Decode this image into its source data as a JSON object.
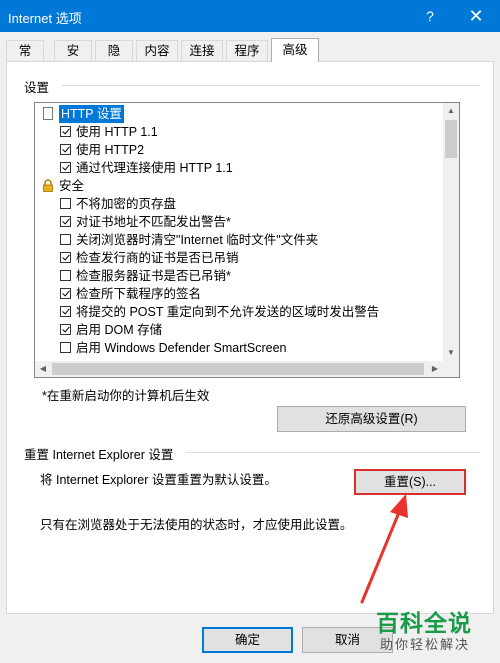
{
  "window": {
    "title": "Internet 选项",
    "help_label": "?",
    "close_label": "✕",
    "accent_color": "#0078d7"
  },
  "tabs": [
    {
      "label": "常规",
      "active": false
    },
    {
      "label": "安全",
      "active": false
    },
    {
      "label": "隐私",
      "active": false
    },
    {
      "label": "内容",
      "active": false
    },
    {
      "label": "连接",
      "active": false
    },
    {
      "label": "程序",
      "active": false
    },
    {
      "label": "高级",
      "active": true
    }
  ],
  "settings": {
    "label": "设置",
    "items": [
      {
        "kind": "category",
        "icon": "document-icon",
        "label": "HTTP 设置",
        "selected": true
      },
      {
        "kind": "option",
        "checked": true,
        "label": "使用 HTTP 1.1"
      },
      {
        "kind": "option",
        "checked": true,
        "label": "使用 HTTP2"
      },
      {
        "kind": "option",
        "checked": true,
        "label": "通过代理连接使用 HTTP 1.1"
      },
      {
        "kind": "category",
        "icon": "lock-icon",
        "label": "安全",
        "selected": false
      },
      {
        "kind": "option",
        "checked": false,
        "label": "不将加密的页存盘"
      },
      {
        "kind": "option",
        "checked": true,
        "label": "对证书地址不匹配发出警告*"
      },
      {
        "kind": "option",
        "checked": false,
        "label": "关闭浏览器时清空\"Internet 临时文件\"文件夹"
      },
      {
        "kind": "option",
        "checked": true,
        "label": "检查发行商的证书是否已吊销"
      },
      {
        "kind": "option",
        "checked": false,
        "label": "检查服务器证书是否已吊销*"
      },
      {
        "kind": "option",
        "checked": true,
        "label": "检查所下载程序的签名"
      },
      {
        "kind": "option",
        "checked": true,
        "label": "将提交的 POST 重定向到不允许发送的区域时发出警告"
      },
      {
        "kind": "option",
        "checked": true,
        "label": "启用 DOM 存储"
      },
      {
        "kind": "option",
        "checked": false,
        "label": "启用 Windows Defender SmartScreen"
      }
    ],
    "restart_note": "*在重新启动你的计算机后生效",
    "restore_button": "还原高级设置(R)"
  },
  "reset": {
    "label": "重置 Internet Explorer 设置",
    "description": "将 Internet Explorer 设置重置为默认设置。",
    "button": "重置(S)...",
    "warning": "只有在浏览器处于无法使用的状态时，才应使用此设置。"
  },
  "footer": {
    "ok_button": "确定",
    "cancel_button": "取消"
  },
  "watermark": {
    "title": "百科全说",
    "subtitle": "助你轻松解决"
  }
}
